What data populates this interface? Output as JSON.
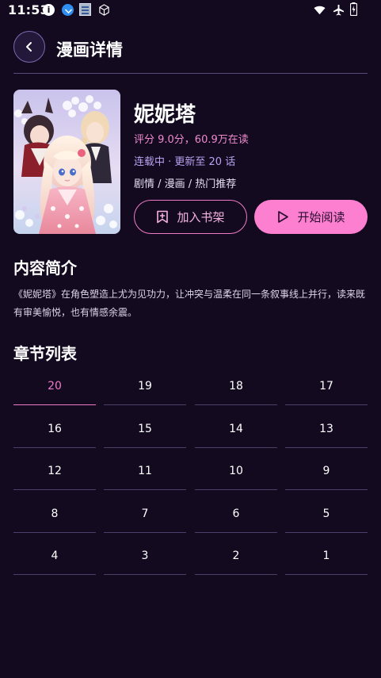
{
  "status_bar": {
    "time": "11:53",
    "icons": [
      "info-icon",
      "download-icon",
      "news-icon",
      "cube-icon",
      "wifi-icon",
      "airplane-icon",
      "battery-icon"
    ]
  },
  "header": {
    "title": "漫画详情",
    "back_icon": "chevron-left-icon"
  },
  "comic": {
    "title": "妮妮塔",
    "rating_line": "评分 9.0分，60.9万在读",
    "status_line": "连载中 · 更新至 20 话",
    "tags_line": "剧情 / 漫画 / 热门推荐",
    "shelf_button": "加入书架",
    "read_button": "开始阅读"
  },
  "intro": {
    "heading": "内容简介",
    "text": "《妮妮塔》在角色塑造上尤为见功力，让冲突与温柔在同一条叙事线上并行，读来既有审美愉悦，也有情感余震。"
  },
  "chapters": {
    "heading": "章节列表",
    "items": [
      "20",
      "19",
      "18",
      "17",
      "16",
      "15",
      "14",
      "13",
      "12",
      "11",
      "10",
      "9",
      "8",
      "7",
      "6",
      "5",
      "4",
      "3",
      "2",
      "1"
    ],
    "active": "20"
  },
  "colors": {
    "background": "#130a20",
    "accent_pink": "#fc7fd0",
    "accent_purple": "#b8a2f0"
  }
}
